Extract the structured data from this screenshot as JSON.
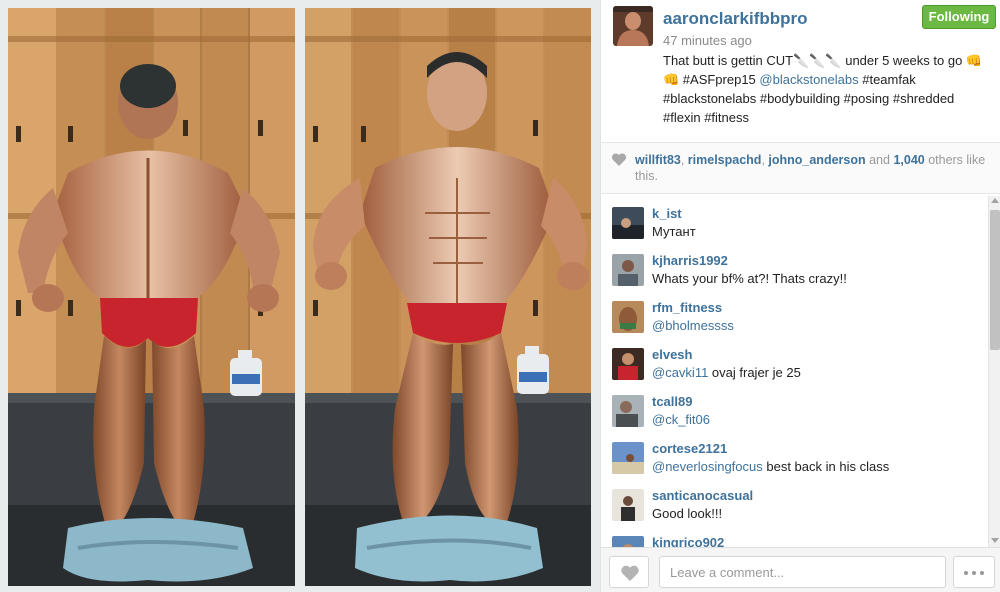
{
  "post": {
    "username": "aaronclarkifbbpro",
    "time_ago": "47 minutes ago",
    "follow_label": "Following",
    "caption_parts": [
      "That butt is gettin CUT🔪🔪🔪 under 5 weeks to go 👊👊 #ASFprep15 ",
      "@blackstonelabs",
      " #teamfak #blackstonelabs #bodybuilding #posing #shredded #flexin #fitness"
    ]
  },
  "likes": {
    "users": [
      "willfit83",
      "rimelspachd",
      "johno_anderson"
    ],
    "sep": ", ",
    "and_text": " and ",
    "count": "1,040",
    "suffix": " others like this."
  },
  "comments": [
    {
      "user": "k_ist",
      "mention": "",
      "text": "Мутант"
    },
    {
      "user": "kjharris1992",
      "mention": "",
      "text": "Whats your bf% at?! Thats crazy!!"
    },
    {
      "user": "rfm_fitness",
      "mention": "@bholmessss",
      "text": ""
    },
    {
      "user": "elvesh",
      "mention": "@cavki11",
      "text": " ovaj frajer je 25"
    },
    {
      "user": "tcall89",
      "mention": "@ck_fit06",
      "text": ""
    },
    {
      "user": "cortese2121",
      "mention": "@neverlosingfocus",
      "text": " best back in his class"
    },
    {
      "user": "santicanocasual",
      "mention": "",
      "text": "Good look!!!"
    },
    {
      "user": "kingrico902",
      "mention": "",
      "text": ""
    }
  ],
  "footer": {
    "comment_placeholder": "Leave a comment..."
  },
  "colors": {
    "link": "#3f729b",
    "following_green": "#6bb843"
  },
  "icons": {
    "heart": "heart-icon",
    "more": "ellipsis-icon"
  }
}
